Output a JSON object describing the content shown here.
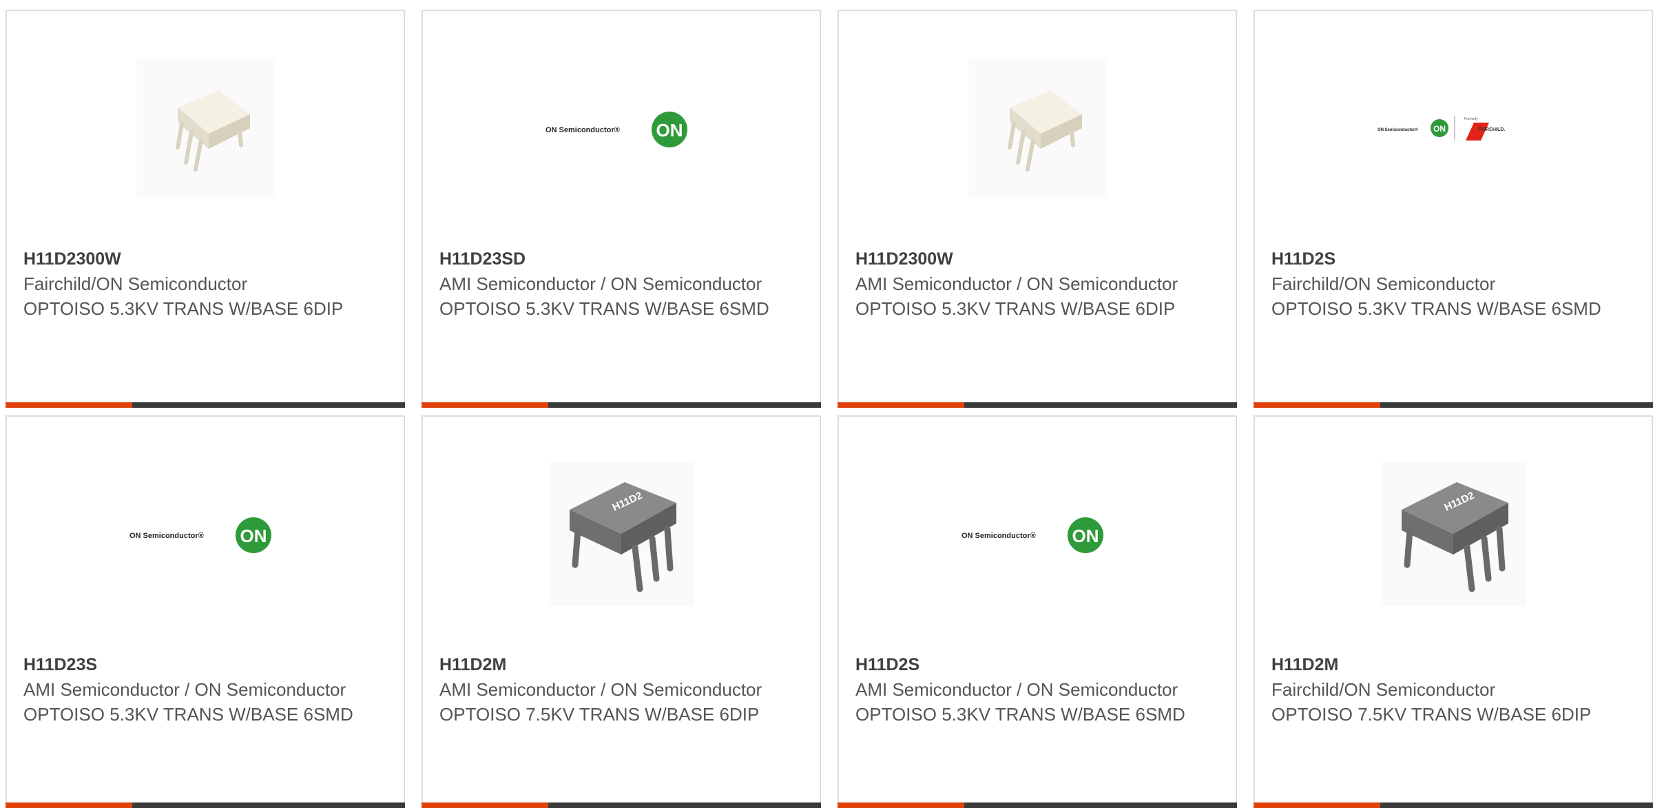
{
  "products": [
    {
      "part_number": "H11D2300W",
      "manufacturer": "Fairchild/ON Semiconductor",
      "description": "OPTOISO 5.3KV TRANS W/BASE 6DIP",
      "image": "white-dip-chip-icon"
    },
    {
      "part_number": "H11D23SD",
      "manufacturer": "AMI Semiconductor / ON Semiconductor",
      "description": "OPTOISO 5.3KV TRANS W/BASE 6SMD",
      "image": "on-semiconductor-logo",
      "logo_text": "ON Semiconductor®",
      "logo_badge": "ON"
    },
    {
      "part_number": "H11D2300W",
      "manufacturer": "AMI Semiconductor / ON Semiconductor",
      "description": "OPTOISO 5.3KV TRANS W/BASE 6DIP",
      "image": "white-dip-chip-icon"
    },
    {
      "part_number": "H11D2S",
      "manufacturer": "Fairchild/ON Semiconductor",
      "description": "OPTOISO 5.3KV TRANS W/BASE 6SMD",
      "image": "on-fairchild-logo",
      "logo_text": "ON Semiconductor®",
      "logo_badge": "ON",
      "logo_formerly": "Formerly",
      "logo_fairchild": "FAIRCHILD."
    },
    {
      "part_number": "H11D23S",
      "manufacturer": "AMI Semiconductor / ON Semiconductor",
      "description": "OPTOISO 5.3KV TRANS W/BASE 6SMD",
      "image": "on-semiconductor-logo",
      "logo_text": "ON Semiconductor®",
      "logo_badge": "ON"
    },
    {
      "part_number": "H11D2M",
      "manufacturer": "AMI Semiconductor / ON Semiconductor",
      "description": "OPTOISO 7.5KV TRANS W/BASE 6DIP",
      "image": "gray-dip-chip-icon",
      "chip_marking": "H11D2"
    },
    {
      "part_number": "H11D2S",
      "manufacturer": "AMI Semiconductor / ON Semiconductor",
      "description": "OPTOISO 5.3KV TRANS W/BASE 6SMD",
      "image": "on-semiconductor-logo",
      "logo_text": "ON Semiconductor®",
      "logo_badge": "ON"
    },
    {
      "part_number": "H11D2M",
      "manufacturer": "Fairchild/ON Semiconductor",
      "description": "OPTOISO 7.5KV TRANS W/BASE 6DIP",
      "image": "gray-dip-chip-icon",
      "chip_marking": "H11D2"
    }
  ],
  "colors": {
    "accent": "#e1420b",
    "bar": "#3a3a3a",
    "on_green": "#2e9a3a",
    "fairchild_red": "#e2231a"
  }
}
